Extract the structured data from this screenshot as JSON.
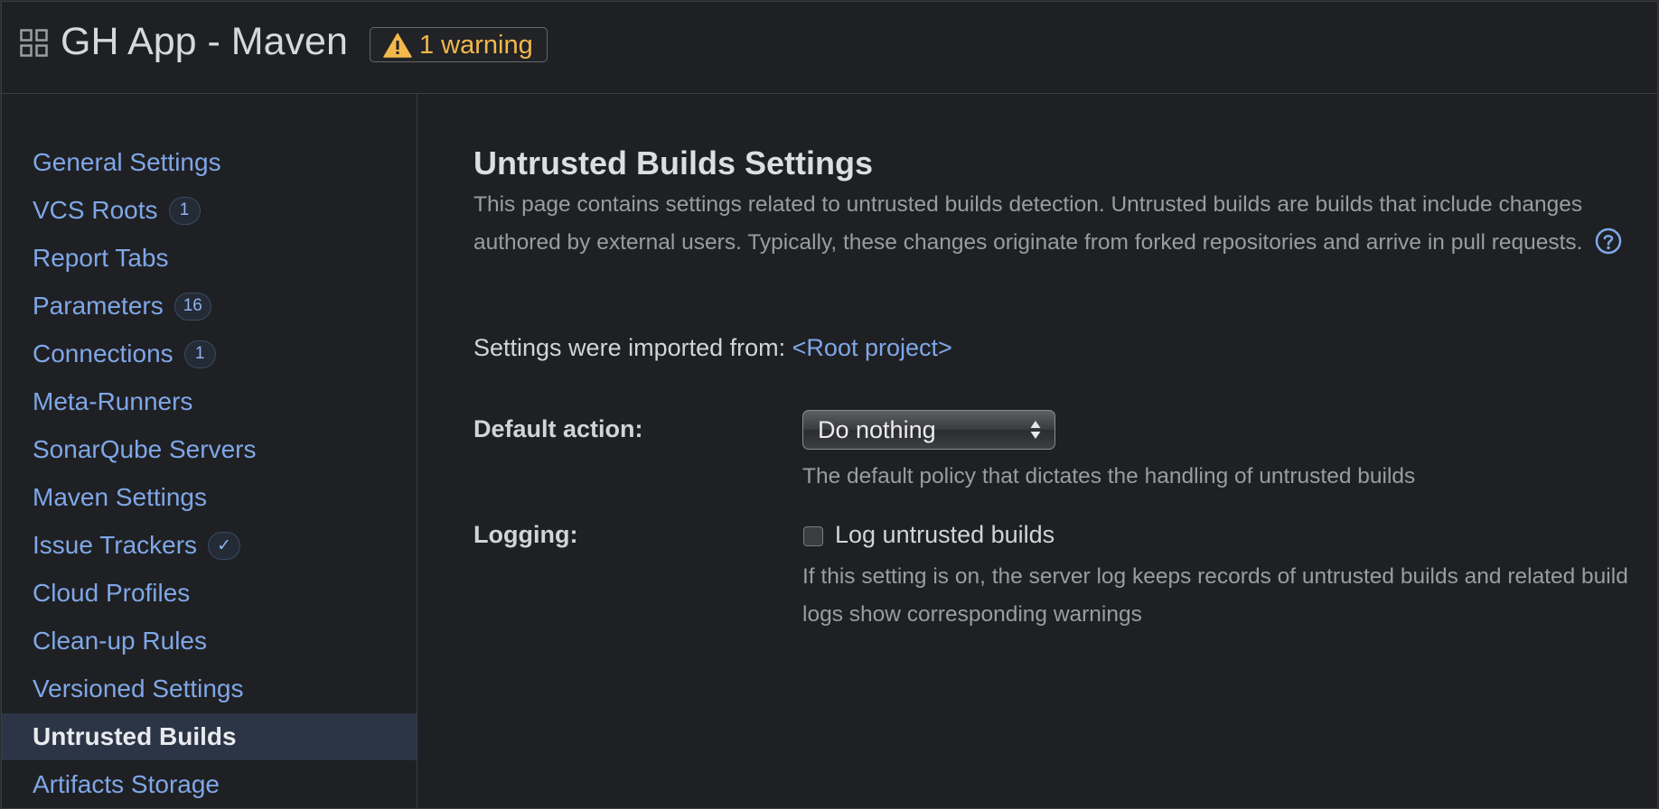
{
  "header": {
    "app_title": "GH App - Maven",
    "warning": "1 warning",
    "warning_color": "#f2b84b"
  },
  "sidebar": {
    "items": [
      {
        "label": "General Settings",
        "badge": ""
      },
      {
        "label": "VCS Roots",
        "badge": "1"
      },
      {
        "label": "Report Tabs",
        "badge": ""
      },
      {
        "label": "Parameters",
        "badge": "16"
      },
      {
        "label": "Connections",
        "badge": "1"
      },
      {
        "label": "Meta-Runners",
        "badge": ""
      },
      {
        "label": "SonarQube Servers",
        "badge": ""
      },
      {
        "label": "Maven Settings",
        "badge": ""
      },
      {
        "label": "Issue Trackers",
        "badge": "✓"
      },
      {
        "label": "Cloud Profiles",
        "badge": ""
      },
      {
        "label": "Clean-up Rules",
        "badge": ""
      },
      {
        "label": "Versioned Settings",
        "badge": ""
      },
      {
        "label": "Untrusted Builds",
        "badge": "",
        "active": true
      },
      {
        "label": "Artifacts Storage",
        "badge": ""
      }
    ],
    "link_color": "#7fa7e8",
    "active_bg": "#2b3545"
  },
  "main": {
    "title": "Untrusted Builds Settings",
    "description": "This page contains settings related to untrusted builds detection. Untrusted builds are builds that include changes authored by external users. Typically, these changes originate from forked repositories and arrive in pull requests.",
    "imported_prefix": "Settings were imported from:",
    "imported_link": "<Root project>",
    "default_action_label": "Default action:",
    "default_action_value": "Do nothing",
    "default_action_hint": "The default policy that dictates the handling of untrusted builds",
    "logging_label": "Logging:",
    "logging_checkbox_label": "Log untrusted builds",
    "logging_checked": false,
    "logging_hint": "If this setting is on, the server log keeps records of untrusted builds and related build logs show corresponding warnings"
  },
  "icons": {
    "app_icon": "grid-icon",
    "warning_icon": "warning-triangle-icon",
    "help_icon": "help-circle-icon",
    "select_icon": "select-arrows-icon"
  }
}
